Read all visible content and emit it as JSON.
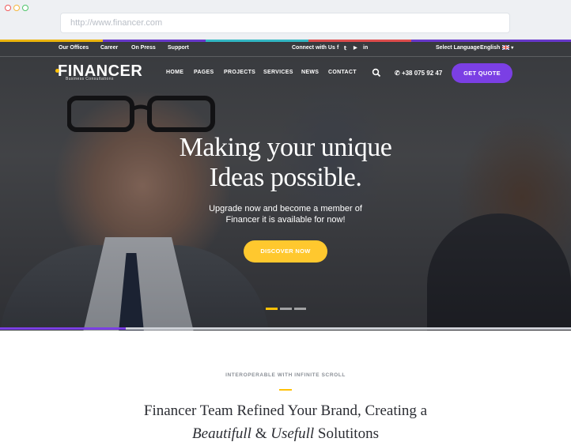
{
  "browser": {
    "url": "http://www.financer.com"
  },
  "topbar": {
    "links": [
      "Our Offices",
      "Career",
      "On Press",
      "Support"
    ],
    "connect_label": "Connect with Us",
    "social_icons": [
      "facebook-icon",
      "twitter-icon",
      "youtube-icon",
      "linkedin-icon"
    ],
    "social_glyphs": [
      "f",
      "𝕥",
      "▶",
      "in"
    ],
    "select_language_label": "Select Language",
    "language_value": "English"
  },
  "nav": {
    "logo": "FINANCER",
    "logo_tagline": "Business Consultations",
    "items": [
      "HOME",
      "PAGES",
      "PROJECTS",
      "SERVICES",
      "NEWS",
      "CONTACT"
    ],
    "phone": "+38 075 92 47",
    "cta": "GET QUOTE"
  },
  "hero": {
    "headline_line1": "Making your unique",
    "headline_line2": "Ideas possible.",
    "sub_line1": "Upgrade now and become a member of",
    "sub_line2": "Financer it is available for now!",
    "button": "DISCOVER NOW",
    "slides_total": 3,
    "active_slide": 1
  },
  "section": {
    "kicker": "INTEROPERABLE WITH INFINITE SCROLL",
    "title_line1": "Financer Team Refined Your Brand, Creating a",
    "title_em1": "Beautifull",
    "title_amp": " & ",
    "title_em2": "Usefull",
    "title_rest": " Solutitons"
  },
  "colors": {
    "accent_purple": "#7b3fe4",
    "accent_yellow": "#ffc82e",
    "text_dark": "#2b2d33"
  }
}
